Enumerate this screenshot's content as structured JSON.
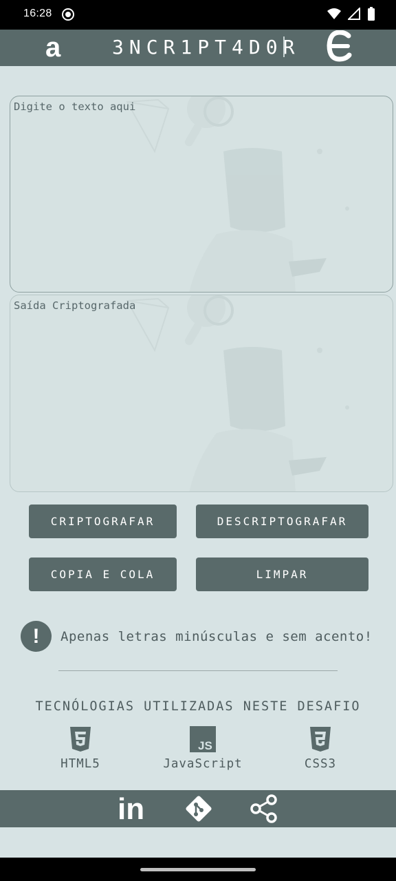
{
  "status_bar": {
    "time": "16:28",
    "icons": [
      "record-icon",
      "wifi-icon",
      "signal-icon",
      "battery-icon"
    ]
  },
  "header": {
    "logo_left": "a",
    "title": "3NCR1PT4D0R",
    "logo_right_icon": "epsilon-logo-icon"
  },
  "input_panel": {
    "placeholder": "Digite o texto aqui"
  },
  "output_panel": {
    "placeholder": "Saída Criptografada"
  },
  "buttons": {
    "encrypt": "CRIPTOGRAFAR",
    "decrypt": "DESCRIPTOGRAFAR",
    "copy": "COPIA E COLA",
    "clear": "LIMPAR"
  },
  "warning": {
    "icon": "!",
    "text": "Apenas letras minúsculas e sem acento!"
  },
  "tech": {
    "title": "TECNÓLOGIAS UTILIZADAS NESTE DESAFIO",
    "items": [
      {
        "icon": "html5-icon",
        "label": "HTML5"
      },
      {
        "icon": "javascript-icon",
        "label": "JavaScript",
        "badge": "JS"
      },
      {
        "icon": "css3-icon",
        "label": "CSS3"
      }
    ]
  },
  "footer": {
    "icons": [
      "linkedin-icon",
      "git-icon",
      "share-icon"
    ],
    "linkedin_text": "in"
  },
  "colors": {
    "primary": "#596a6a",
    "background": "#d7e3e4",
    "text": "#4e5c5e"
  }
}
